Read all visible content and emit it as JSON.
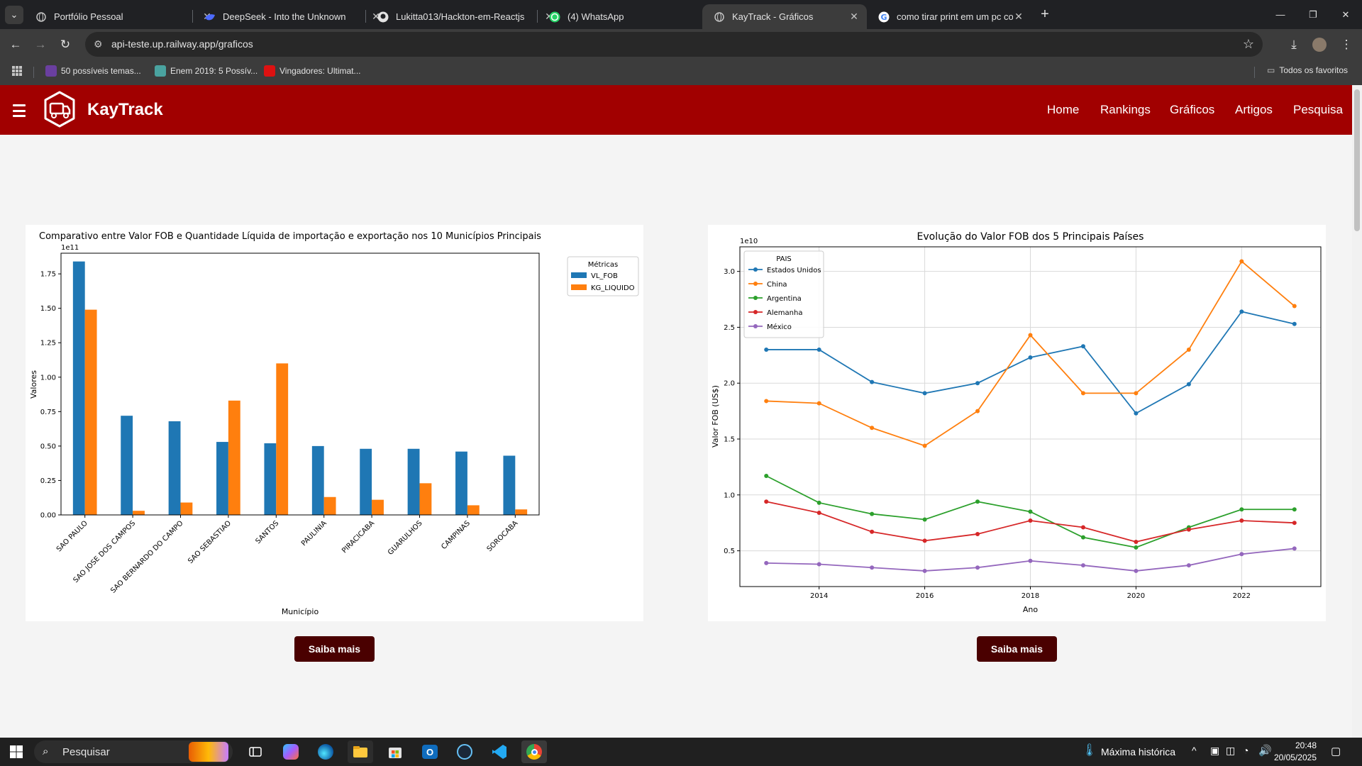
{
  "browser": {
    "tabs": [
      {
        "title": "Portfólio Pessoal"
      },
      {
        "title": "DeepSeek - Into the Unknown"
      },
      {
        "title": "Lukitta013/Hackton-em-Reactjs"
      },
      {
        "title": "(4) WhatsApp"
      },
      {
        "title": "KayTrack - Gráficos",
        "active": true
      },
      {
        "title": "como tirar print em um pc com"
      }
    ],
    "url": "api-teste.up.railway.app/graficos",
    "bookmarks": [
      {
        "label": "50 possíveis temas..."
      },
      {
        "label": "Enem 2019: 5 Possív..."
      },
      {
        "label": "Vingadores: Ultimat..."
      }
    ],
    "all_bookmarks": "Todos os favoritos"
  },
  "site": {
    "brand": "KayTrack",
    "nav": [
      "Home",
      "Rankings",
      "Gráficos",
      "Artigos",
      "Pesquisa"
    ],
    "button_label": "Saiba mais"
  },
  "chart_data": [
    {
      "type": "bar",
      "title": "Comparativo entre Valor FOB e Quantidade Líquida de importação e exportação nos 10 Municípios Principais",
      "xlabel": "Município",
      "ylabel": "Valores",
      "offset_label": "1e11",
      "ylim": [
        0,
        1.9
      ],
      "yticks": [
        "0.00",
        "0.25",
        "0.50",
        "0.75",
        "1.00",
        "1.25",
        "1.50",
        "1.75"
      ],
      "categories": [
        "SAO PAULO",
        "SAO JOSE DOS CAMPOS",
        "SAO BERNARDO DO CAMPO",
        "SAO SEBASTIAO",
        "SANTOS",
        "PAULINIA",
        "PIRACICABA",
        "GUARULHOS",
        "CAMPINAS",
        "SOROCABA"
      ],
      "legend_title": "Métricas",
      "legend_position": "outside top-right",
      "series": [
        {
          "name": "VL_FOB",
          "color": "#1f77b4",
          "values": [
            1.84,
            0.72,
            0.68,
            0.53,
            0.52,
            0.5,
            0.48,
            0.48,
            0.46,
            0.43
          ]
        },
        {
          "name": "KG_LIQUIDO",
          "color": "#ff7f0e",
          "values": [
            1.49,
            0.03,
            0.09,
            0.83,
            1.1,
            0.13,
            0.11,
            0.23,
            0.07,
            0.04
          ]
        }
      ]
    },
    {
      "type": "line",
      "title": "Evolução do Valor FOB dos 5 Principais Países",
      "xlabel": "Ano",
      "ylabel": "Valor FOB (US$)",
      "offset_label": "1e10",
      "xlim": [
        2012.5,
        2023.5
      ],
      "ylim": [
        0.18,
        3.22
      ],
      "xticks": [
        "2014",
        "2016",
        "2018",
        "2020",
        "2022"
      ],
      "yticks": [
        "0.5",
        "1.0",
        "1.5",
        "2.0",
        "2.5",
        "3.0"
      ],
      "grid": true,
      "legend_title": "PAIS",
      "legend_position": "top-left",
      "x": [
        2013,
        2014,
        2015,
        2016,
        2017,
        2018,
        2019,
        2020,
        2021,
        2022,
        2023
      ],
      "series": [
        {
          "name": "Estados Unidos",
          "color": "#1f77b4",
          "values": [
            2.3,
            2.3,
            2.01,
            1.91,
            2.0,
            2.23,
            2.33,
            1.73,
            1.99,
            2.64,
            2.53
          ]
        },
        {
          "name": "China",
          "color": "#ff7f0e",
          "values": [
            1.84,
            1.82,
            1.6,
            1.44,
            1.75,
            2.43,
            1.91,
            1.91,
            2.3,
            3.09,
            2.69
          ]
        },
        {
          "name": "Argentina",
          "color": "#2ca02c",
          "values": [
            1.17,
            0.93,
            0.83,
            0.78,
            0.94,
            0.85,
            0.62,
            0.53,
            0.71,
            0.87,
            0.87
          ]
        },
        {
          "name": "Alemanha",
          "color": "#d62728",
          "values": [
            0.94,
            0.84,
            0.67,
            0.59,
            0.65,
            0.77,
            0.71,
            0.58,
            0.69,
            0.77,
            0.75
          ]
        },
        {
          "name": "México",
          "color": "#9467bd",
          "values": [
            0.39,
            0.38,
            0.35,
            0.32,
            0.35,
            0.41,
            0.37,
            0.32,
            0.37,
            0.47,
            0.52
          ]
        }
      ]
    }
  ],
  "taskbar": {
    "search_placeholder": "Pesquisar",
    "weather": "Máxima histórica",
    "time": "20:48",
    "date": "20/05/2025"
  }
}
